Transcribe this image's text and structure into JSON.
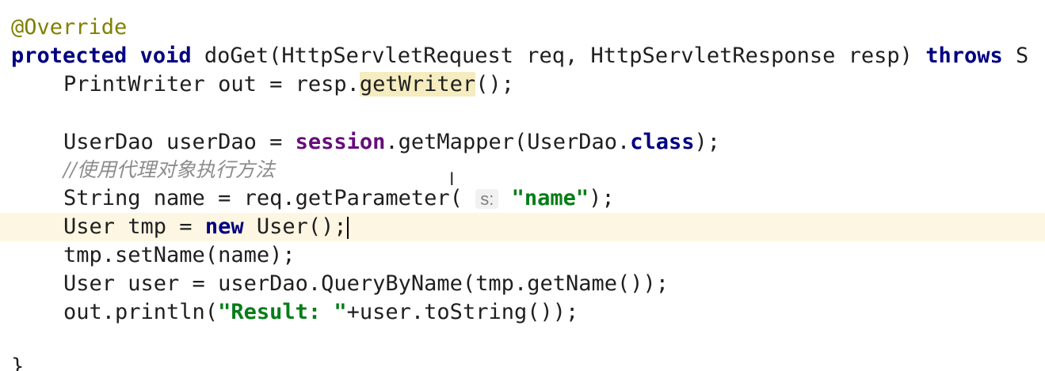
{
  "code": {
    "annotation": "@Override",
    "signature": {
      "kw_protected": "protected",
      "kw_void": "void",
      "rest": "doGet(HttpServletRequest req, HttpServletResponse resp)",
      "kw_throws": "throws",
      "overflow": "S"
    },
    "line3": {
      "pre": "PrintWriter out = resp.",
      "method": "getWriter",
      "post": "();"
    },
    "line5": {
      "pre": "UserDao userDao = ",
      "field": "session",
      "mid": ".getMapper(UserDao.",
      "kw_class": "class",
      "post": ");"
    },
    "comment": "//使用代理对象执行方法",
    "line7": {
      "pre": "String name = req.getParameter(",
      "hint": "s:",
      "str": "\"name\"",
      "post": ");"
    },
    "line8": {
      "pre": "User tmp = ",
      "kw_new": "new",
      "post": " User();"
    },
    "line9": "tmp.setName(name);",
    "line10": "User user = userDao.QueryByName(tmp.getName());",
    "line11": {
      "pre": "out.println(",
      "str": "\"Result: \"",
      "post": "+user.toString());"
    },
    "closing_brace": "}"
  }
}
